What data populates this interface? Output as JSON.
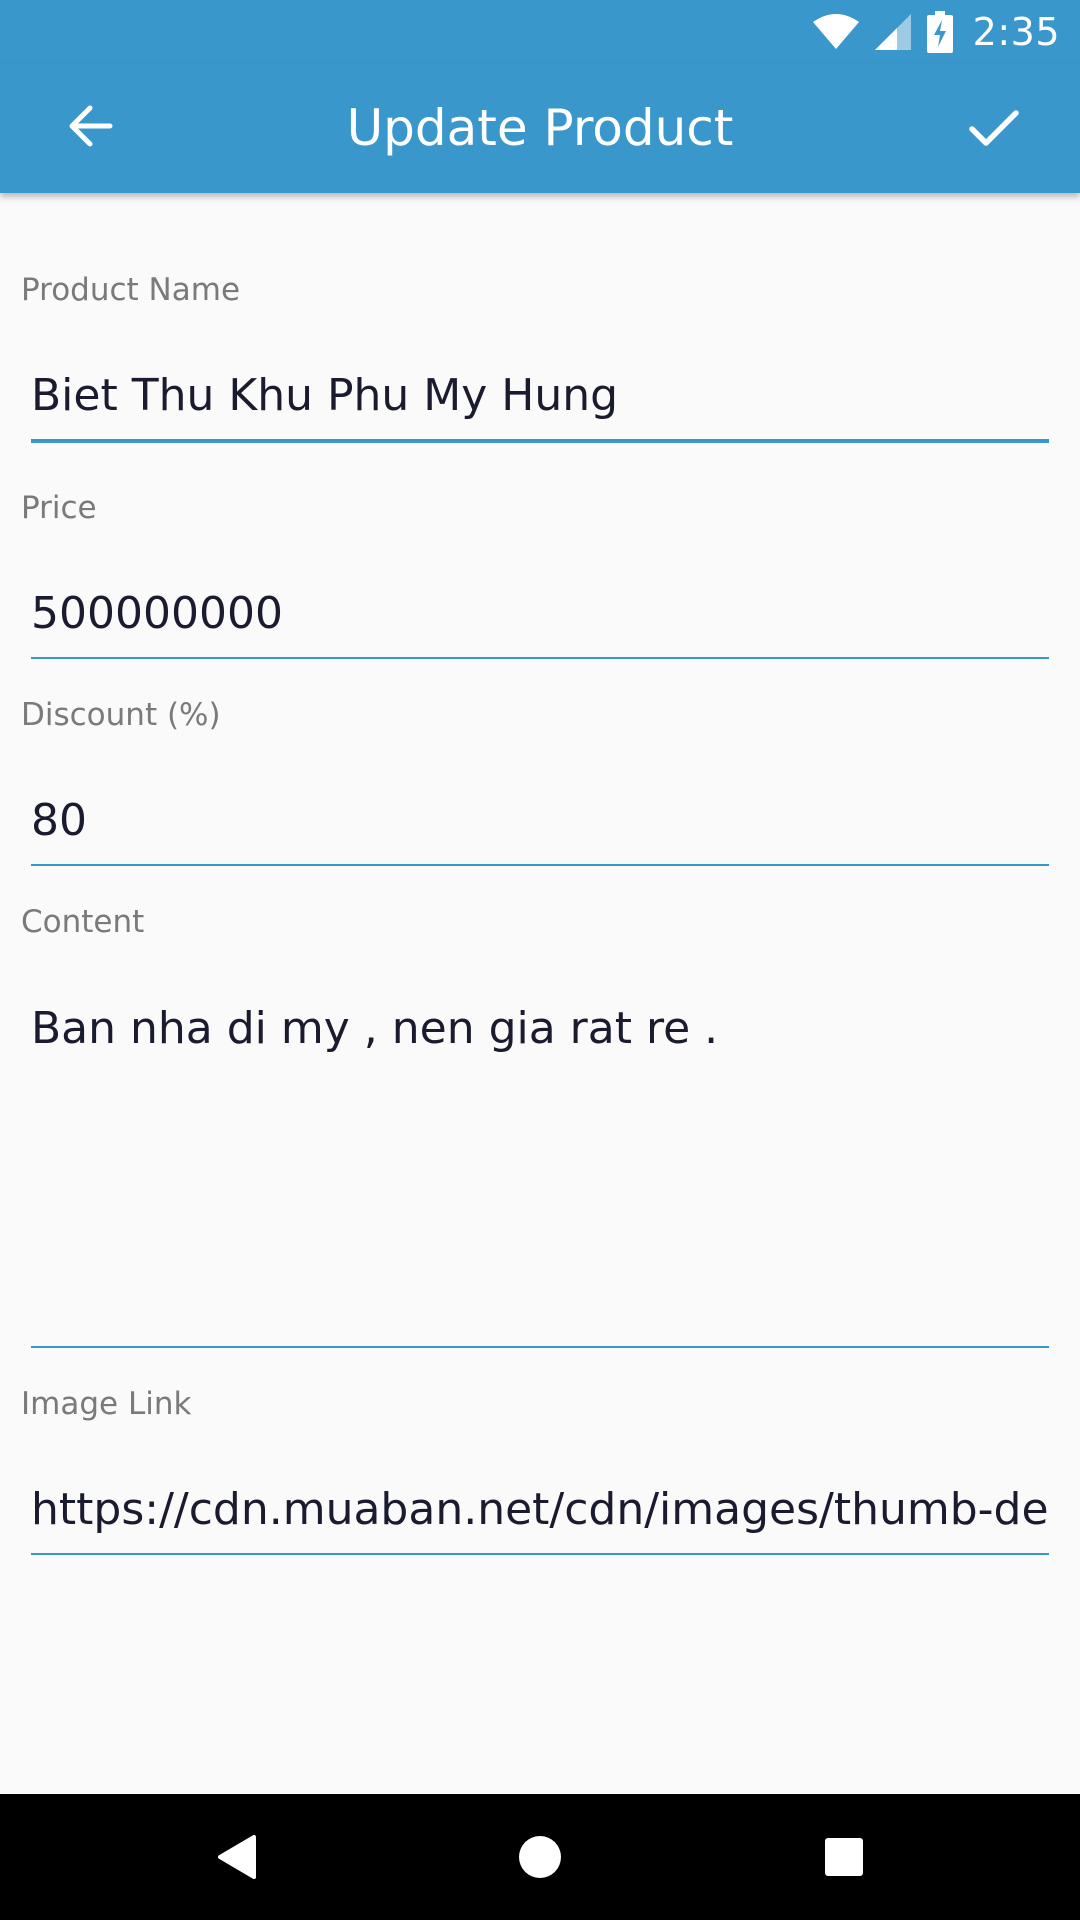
{
  "status_bar": {
    "time": "2:35",
    "icons": [
      "wifi-icon",
      "cellular-signal-icon",
      "battery-charging-icon"
    ]
  },
  "app_bar": {
    "title": "Update Product",
    "back_icon": "arrow-back-icon",
    "save_icon": "check-icon",
    "background_color": "#3a97cc"
  },
  "form": {
    "product_name": {
      "label": "Product Name",
      "value": "Biet Thu Khu Phu My Hung"
    },
    "price": {
      "label": "Price",
      "value": "500000000"
    },
    "discount": {
      "label": "Discount (%)",
      "value": "80"
    },
    "content": {
      "label": "Content",
      "value": "Ban nha di my , nen gia rat re ."
    },
    "image_link": {
      "label": "Image Link",
      "value": "https://cdn.muaban.net/cdn/images/thumb-deta"
    }
  },
  "nav_bar": {
    "icons": [
      "back-triangle-icon",
      "home-circle-icon",
      "recents-square-icon"
    ]
  }
}
